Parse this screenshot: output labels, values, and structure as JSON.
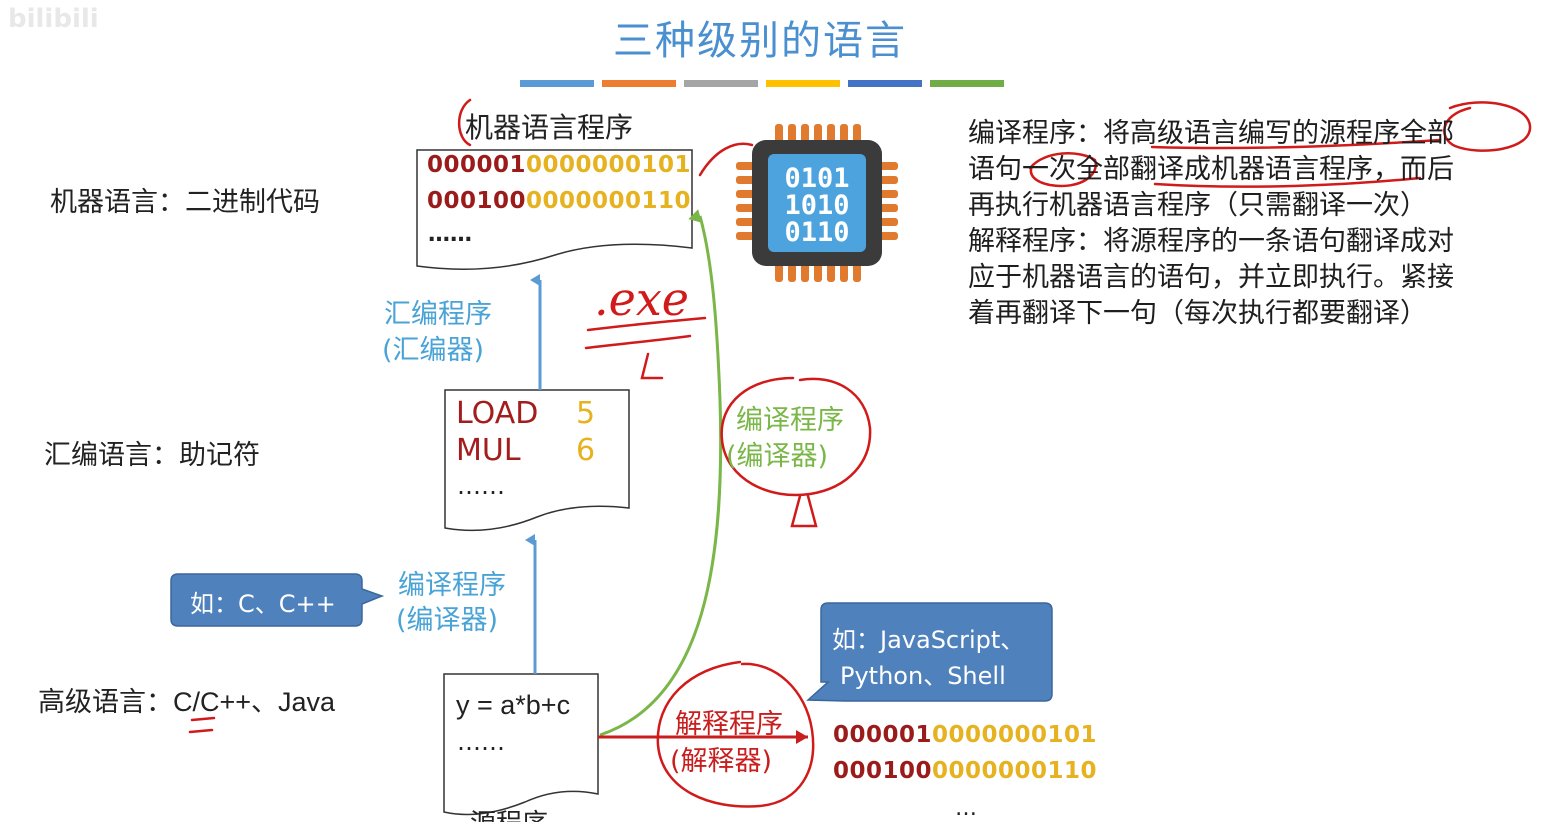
{
  "watermark": "bilibili",
  "title": "三种级别的语言",
  "title_bar_colors": [
    "#5b9bd5",
    "#ed7d31",
    "#a5a5a5",
    "#ffc000",
    "#4472c4",
    "#70ad47"
  ],
  "levels": {
    "machine": "机器语言：二进制代码",
    "assembly": "汇编语言：助记符",
    "high": {
      "prefix": "高级语言：",
      "examples": "C/C++、Java"
    }
  },
  "machine_program": {
    "label": "机器语言程序",
    "lines": [
      {
        "red": "000001",
        "gold": "0000000101"
      },
      {
        "red": "000100",
        "gold": "0000000110"
      }
    ],
    "ellipsis": "……"
  },
  "assembly_program": {
    "lines": [
      {
        "op": "LOAD",
        "val": "5"
      },
      {
        "op": "MUL",
        "val": "6"
      }
    ],
    "ellipsis": "……"
  },
  "source_program": {
    "label": "源程序",
    "line": "y = a*b+c",
    "ellipsis": "……"
  },
  "assembler": {
    "line1": "汇编程序",
    "line2": "(汇编器)"
  },
  "compiler_left": {
    "line1": "编译程序",
    "line2": "(编译器)"
  },
  "compiler_green": {
    "line1": "编译程序",
    "line2": "(编译器)"
  },
  "interpreter": {
    "line1": "解释程序",
    "line2": "(解释器)"
  },
  "callout_compiled": "如：C、C++",
  "callout_interpreted": {
    "line1": "如：JavaScript、",
    "line2": "Python、Shell"
  },
  "interp_output": {
    "lines": [
      {
        "red": "000001",
        "gold": "0000000101"
      },
      {
        "red": "000100",
        "gold": "0000000110"
      }
    ],
    "ellipsis": "…"
  },
  "chip_digits": [
    "0101",
    "1010",
    "0110"
  ],
  "exe_note": ".exe",
  "right_notes": [
    "编译程序：将高级语言编写的源程序全部",
    "语句一次全部翻译成机器语言程序，而后",
    "再执行机器语言程序（只需翻译一次）",
    "解释程序：将源程序的一条语句翻译成对",
    "应于机器语言的语句，并立即执行。紧接",
    "着再翻译下一句（每次执行都要翻译）"
  ]
}
